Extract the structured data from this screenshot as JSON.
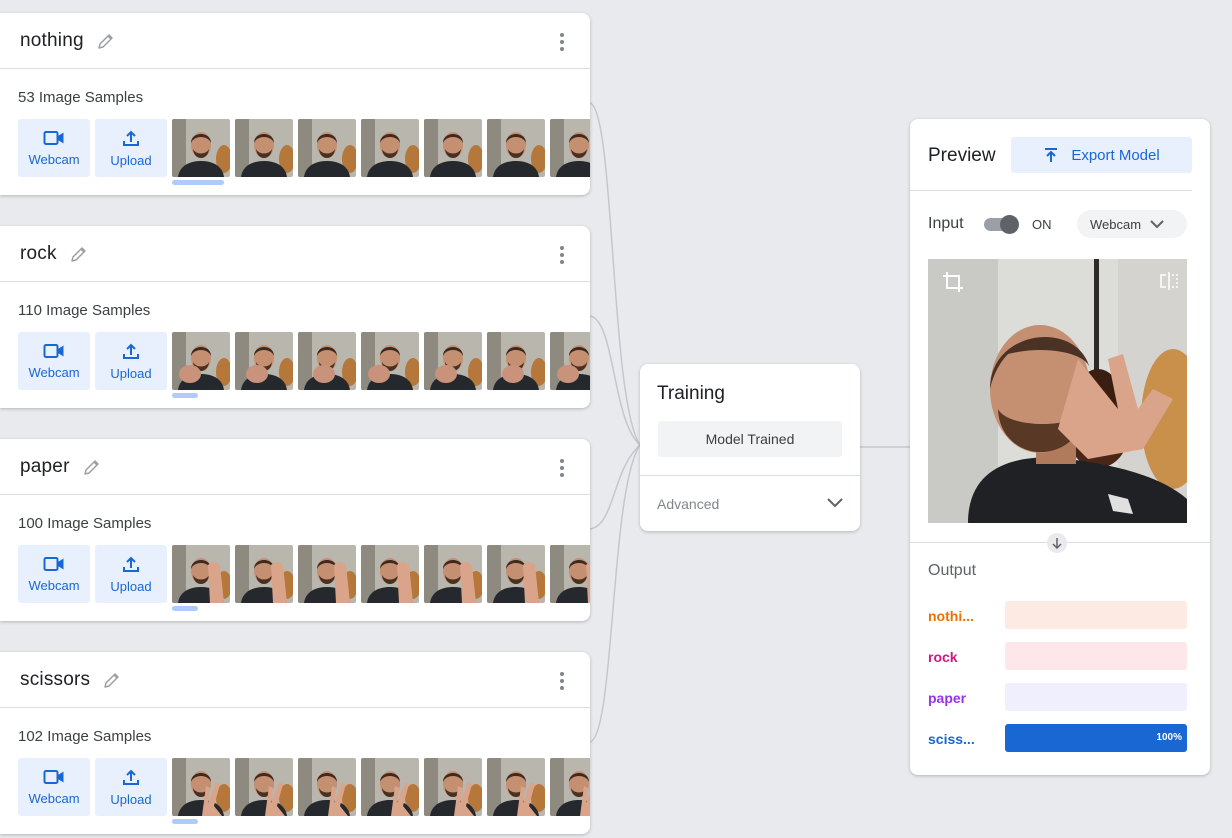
{
  "classes": [
    {
      "name": "nothing",
      "samples": "53 Image Samples",
      "webcam_label": "Webcam",
      "upload_label": "Upload"
    },
    {
      "name": "rock",
      "samples": "110 Image Samples",
      "webcam_label": "Webcam",
      "upload_label": "Upload"
    },
    {
      "name": "paper",
      "samples": "100 Image Samples",
      "webcam_label": "Webcam",
      "upload_label": "Upload"
    },
    {
      "name": "scissors",
      "samples": "102 Image Samples",
      "webcam_label": "Webcam",
      "upload_label": "Upload"
    }
  ],
  "training": {
    "title": "Training",
    "status_button": "Model Trained",
    "advanced_label": "Advanced"
  },
  "preview": {
    "title": "Preview",
    "export_label": "Export Model",
    "input_label": "Input",
    "toggle_state": "ON",
    "input_source": "Webcam",
    "output_label": "Output",
    "outputs": [
      {
        "label": "nothi...",
        "color": "#e8710a",
        "bg": "#fdeae2",
        "confidence": 0,
        "percent": ""
      },
      {
        "label": "rock",
        "color": "#d01884",
        "bg": "#fde7ea",
        "confidence": 0,
        "percent": ""
      },
      {
        "label": "paper",
        "color": "#9334e6",
        "bg": "#f0effd",
        "confidence": 0,
        "percent": ""
      },
      {
        "label": "sciss...",
        "color": "#1967d2",
        "bg": "#e8f0fe",
        "confidence": 1,
        "percent": "100%"
      }
    ]
  },
  "colors": {
    "accent": "#1967d2",
    "accent_bg": "#e8f0fe",
    "bar_fill": "#1967d2"
  }
}
